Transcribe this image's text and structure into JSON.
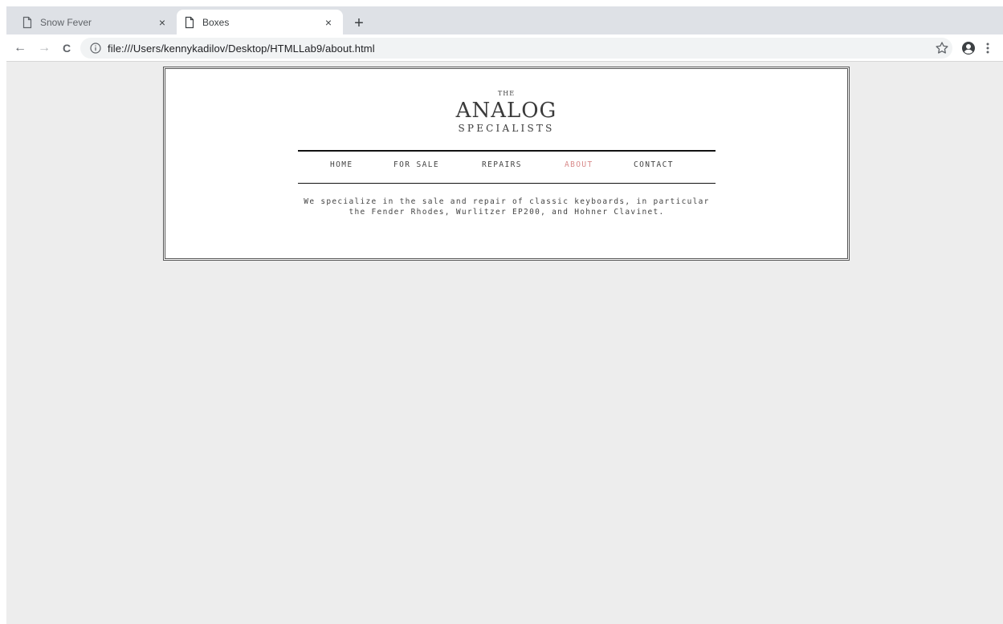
{
  "browser": {
    "tabs": [
      {
        "title": "Snow Fever",
        "close_label": "×"
      },
      {
        "title": "Boxes",
        "close_label": "×"
      }
    ],
    "new_tab_label": "+",
    "back_label": "←",
    "forward_label": "→",
    "reload_label": "C",
    "url": "file:///Users/kennykadilov/Desktop/HTMLLab9/about.html"
  },
  "page": {
    "logo": {
      "the": "THE",
      "analog": "ANALOG",
      "specialists": "SPECIALISTS"
    },
    "nav": [
      {
        "label": "HOME",
        "active": false
      },
      {
        "label": "FOR SALE",
        "active": false
      },
      {
        "label": "REPAIRS",
        "active": false
      },
      {
        "label": "ABOUT",
        "active": true
      },
      {
        "label": "CONTACT",
        "active": false
      }
    ],
    "intro": "We specialize in the sale and repair of classic keyboards, in particular the Fender Rhodes, Wurlitzer EP200, and Hohner Clavinet.",
    "accent_color": "#d98a8a"
  }
}
